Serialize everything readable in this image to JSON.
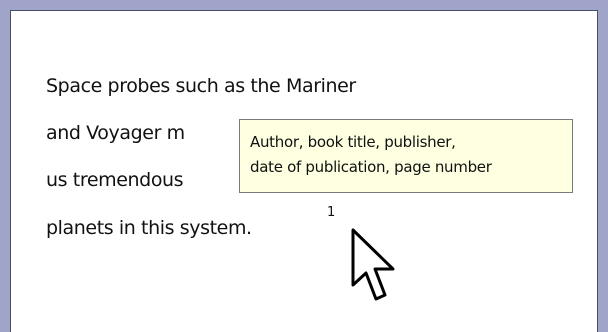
{
  "document": {
    "lines": [
      "Space probes such as the Mariner",
      "and Voyager m",
      "us tremendous",
      "planets in this system."
    ],
    "footnote_marker": "1"
  },
  "tooltip": {
    "line1": "Author, book title, publisher,",
    "line2": "date of publication, page number"
  },
  "cursor": {
    "icon": "arrow-pointer-icon"
  },
  "colors": {
    "frame": "#a1a4c9",
    "page_background": "#ffffff",
    "tooltip_background": "#ffffe1"
  }
}
